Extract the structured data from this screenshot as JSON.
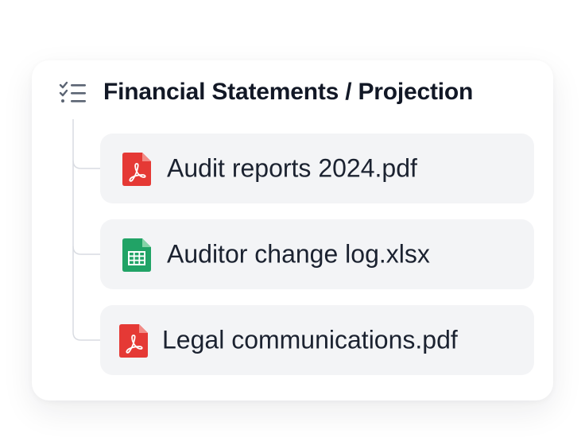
{
  "folder": {
    "title": "Financial Statements / Projection",
    "icon": "checklist-icon"
  },
  "files": [
    {
      "name": "Audit reports 2024.pdf",
      "icon": "pdf-icon",
      "color": "#e53935"
    },
    {
      "name": "Auditor change log.xlsx",
      "icon": "spreadsheet-icon",
      "color": "#21a366"
    },
    {
      "name": "Legal communications.pdf",
      "icon": "pdf-icon",
      "color": "#e53935"
    }
  ]
}
